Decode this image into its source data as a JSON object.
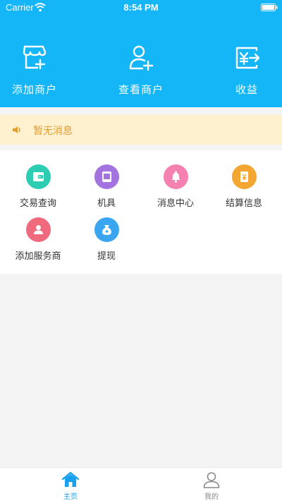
{
  "status_bar": {
    "carrier": "Carrier",
    "time": "8:54 PM"
  },
  "header": {
    "background": "#15b6f8",
    "quick_actions": [
      {
        "label": "添加商户",
        "icon": "add-store-icon"
      },
      {
        "label": "查看商户",
        "icon": "add-user-icon"
      },
      {
        "label": "收益",
        "icon": "yuan-exchange-icon"
      }
    ]
  },
  "notice": {
    "text": "暂无消息",
    "icon": "speaker-icon",
    "color": "#e59b2e",
    "background": "#fdf1d0"
  },
  "menu": [
    {
      "label": "交易查询",
      "icon": "wallet-icon",
      "color": "#2ccdb2"
    },
    {
      "label": "机具",
      "icon": "device-icon",
      "color": "#a373e0"
    },
    {
      "label": "消息中心",
      "icon": "bell-icon",
      "color": "#f581b0"
    },
    {
      "label": "结算信息",
      "icon": "settlement-yuan-icon",
      "color": "#f3a631"
    },
    {
      "label": "添加服务商",
      "icon": "person-icon",
      "color": "#f06a7e"
    },
    {
      "label": "提现",
      "icon": "money-bag-icon",
      "color": "#3aa6f2"
    }
  ],
  "tabbar": {
    "active_color": "#1aa0f0",
    "inactive_color": "#8a8a8a",
    "tabs": [
      {
        "label": "主页",
        "icon": "home-icon",
        "active": true
      },
      {
        "label": "我的",
        "icon": "profile-icon",
        "active": false
      }
    ]
  }
}
